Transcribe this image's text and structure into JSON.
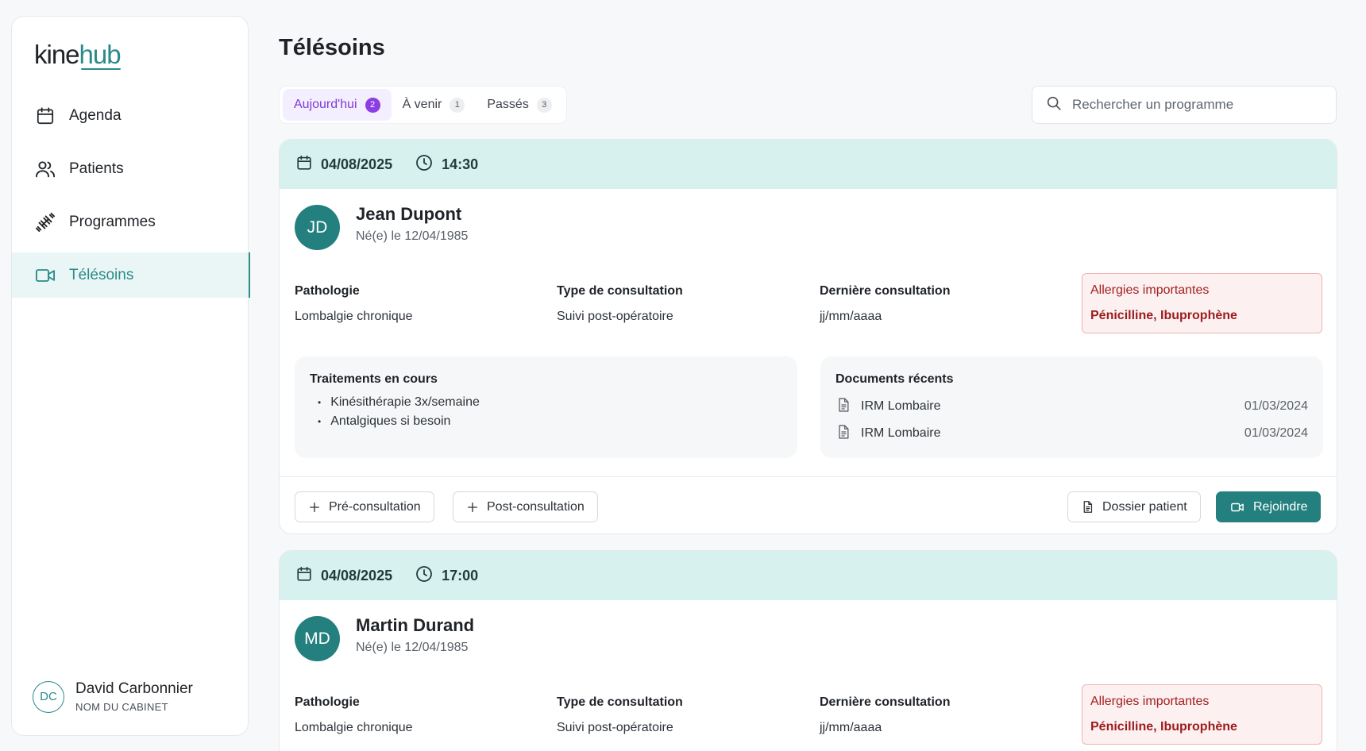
{
  "app": {
    "logo_part1": "kine",
    "logo_part2": "hub"
  },
  "sidebar": {
    "items": [
      {
        "label": "Agenda",
        "icon": "calendar-icon",
        "active": false
      },
      {
        "label": "Patients",
        "icon": "users-icon",
        "active": false
      },
      {
        "label": "Programmes",
        "icon": "dumbbell-icon",
        "active": false
      },
      {
        "label": "Télésoins",
        "icon": "video-icon",
        "active": true
      }
    ],
    "user": {
      "initials": "DC",
      "name": "David Carbonnier",
      "cabinet": "NOM DU CABINET"
    }
  },
  "page": {
    "title": "Télésoins"
  },
  "tabs": [
    {
      "label": "Aujourd'hui",
      "count": "2",
      "active": true
    },
    {
      "label": "À venir",
      "count": "1",
      "active": false
    },
    {
      "label": "Passés",
      "count": "3",
      "active": false
    }
  ],
  "search": {
    "placeholder": "Rechercher un programme",
    "value": ""
  },
  "consultations": [
    {
      "date": "04/08/2025",
      "time": "14:30",
      "initials": "JD",
      "name": "Jean Dupont",
      "dob": "Né(e) le 12/04/1985",
      "pathologie_label": "Pathologie",
      "pathologie": "Lombalgie chronique",
      "type_label": "Type de consultation",
      "type": "Suivi post-opératoire",
      "last_label": "Dernière consultation",
      "last": "jj/mm/aaaa",
      "allergies_label": "Allergies importantes",
      "allergies": "Pénicilline, Ibuprophène",
      "treatments_title": "Traitements en cours",
      "treatments": [
        "Kinésithérapie 3x/semaine",
        "Antalgiques si besoin"
      ],
      "documents_title": "Documents récents",
      "documents": [
        {
          "name": "IRM Lombaire",
          "date": "01/03/2024"
        },
        {
          "name": "IRM Lombaire",
          "date": "01/03/2024"
        }
      ],
      "actions": {
        "pre": "Pré-consultation",
        "post": "Post-consultation",
        "dossier": "Dossier patient",
        "join": "Rejoindre"
      }
    },
    {
      "date": "04/08/2025",
      "time": "17:00",
      "initials": "MD",
      "name": "Martin Durand",
      "dob": "Né(e) le 12/04/1985",
      "pathologie_label": "Pathologie",
      "pathologie": "Lombalgie chronique",
      "type_label": "Type de consultation",
      "type": "Suivi post-opératoire",
      "last_label": "Dernière consultation",
      "last": "jj/mm/aaaa",
      "allergies_label": "Allergies importantes",
      "allergies": "Pénicilline, Ibuprophène"
    }
  ],
  "colors": {
    "accent": "#2a8a8a",
    "header_bg": "#d6f1ee",
    "tab_active": "#8a3ee3",
    "allergy": "#9b1c1c"
  }
}
